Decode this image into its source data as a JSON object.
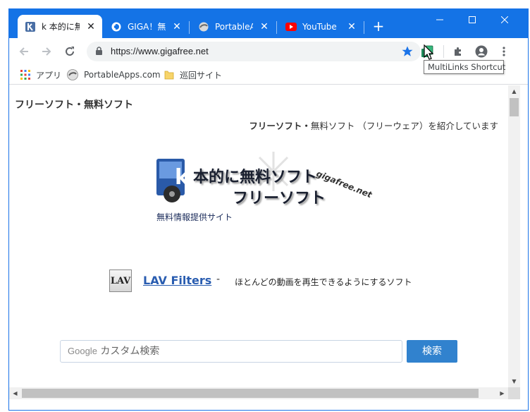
{
  "tabs": [
    {
      "label": "k 本的に無",
      "icon": "k-favicon-icon",
      "active": true
    },
    {
      "label": "GIGA！無料",
      "icon": "giga-favicon-icon",
      "active": false
    },
    {
      "label": "PortableAp",
      "icon": "portableapps-favicon-icon",
      "active": false
    },
    {
      "label": "YouTube",
      "icon": "youtube-favicon-icon",
      "active": false
    }
  ],
  "new_tab_label": "+",
  "window_controls": {
    "minimize": "—",
    "maximize": "☐",
    "close": "✕"
  },
  "toolbar": {
    "url": "https://www.gigafree.net"
  },
  "bookmarks": [
    {
      "label": "アプリ",
      "icon": "apps-grid-icon"
    },
    {
      "label": "PortableApps.com",
      "icon": "portableapps-icon"
    },
    {
      "label": "巡回サイト",
      "icon": "folder-icon"
    }
  ],
  "tooltip": "MultiLinks Shortcut",
  "page": {
    "title": "フリーソフト・無料ソフト",
    "intro_bold": "フリーソフト・",
    "intro_rest": "無料ソフト （フリーウェア）を紹介しています",
    "logo": {
      "line1": "本的に無料ソフト",
      "line2": "フリーソフト",
      "site": "gigafree.net",
      "sub": "無料情報提供サイト",
      "letter": "k"
    },
    "feature": {
      "icon_text": "LAV",
      "link": "LAV Filters",
      "dash": "-",
      "desc": "ほとんどの動画を再生できるようにするソフト"
    },
    "search": {
      "placeholder_brand": "Google",
      "placeholder_text": "カスタム検索",
      "button": "検索"
    }
  },
  "colors": {
    "titlebar": "#1473e6",
    "accent": "#1a73e8",
    "search_button": "#3182ce",
    "link": "#2a5db0"
  }
}
